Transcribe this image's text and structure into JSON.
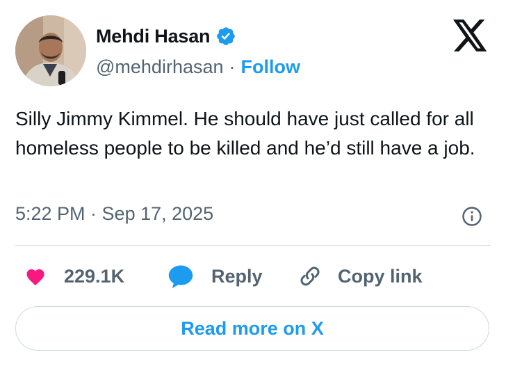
{
  "author": {
    "display_name": "Mehdi Hasan",
    "handle": "@mehdirhasan",
    "separator": "·",
    "follow_label": "Follow",
    "verified": true,
    "avatar": "profile-photo"
  },
  "tweet": {
    "text": "Silly Jimmy Kimmel. He should have just called for all homeless people to be killed and he’d still have a job.",
    "timestamp": "5:22 PM · Sep 17, 2025"
  },
  "actions": {
    "like_count": "229.1K",
    "reply_label": "Reply",
    "copy_link_label": "Copy link"
  },
  "footer": {
    "read_more_label": "Read more on X"
  },
  "icons": {
    "brand": "x-logo-icon",
    "verified": "verified-badge-icon",
    "info": "info-icon",
    "like": "heart-icon",
    "reply": "speech-bubble-icon",
    "copy": "link-icon"
  },
  "colors": {
    "text": "#0f1419",
    "muted": "#536471",
    "accent": "#1d9bf0",
    "like": "#f91880",
    "border": "#cfd9de"
  }
}
